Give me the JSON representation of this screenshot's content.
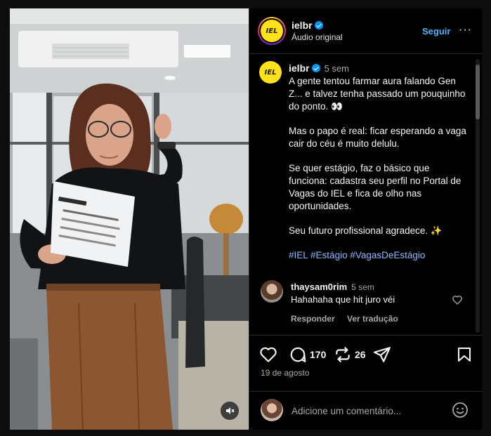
{
  "post": {
    "author": {
      "username": "ielbr",
      "verified": true,
      "logo_text": "IEL",
      "audio": "Áudio original",
      "follow_label": "Seguir",
      "more_label": "···"
    },
    "caption": {
      "time": "5 sem",
      "paragraphs": [
        "A gente tentou farmar aura falando Gen Z... e talvez tenha passado um pouquinho do ponto. 👀",
        "Mas o papo é real: ficar esperando a vaga cair do céu é muito delulu.",
        "Se quer estágio, faz o básico que funciona: cadastra seu perfil no Portal de Vagas do IEL e fica de olho nas oportunidades.",
        "Seu futuro profissional agradece. ✨"
      ],
      "hashtags": [
        "#IEL",
        "#Estágio",
        "#VagasDeEstágio"
      ]
    },
    "comments": [
      {
        "username": "thaysam0rim",
        "time": "5 sem",
        "text": "Hahahaha que hit juro véi",
        "reply_label": "Responder",
        "translate_label": "Ver tradução"
      }
    ],
    "stats": {
      "comments_count": "170",
      "reposts_count": "26",
      "date": "19 de agosto"
    },
    "composer": {
      "placeholder": "Adicione um comentário..."
    },
    "icons": [
      "verified-badge-icon",
      "more-icon",
      "heart-icon",
      "comment-icon",
      "repost-icon",
      "share-icon",
      "bookmark-icon",
      "emoji-icon",
      "mute-icon"
    ],
    "colors": {
      "accent": "#4cb5f9",
      "hashtag": "#8fb7ff",
      "logo_yellow": "#fde21a",
      "muted_text": "#a8a8a8"
    }
  }
}
